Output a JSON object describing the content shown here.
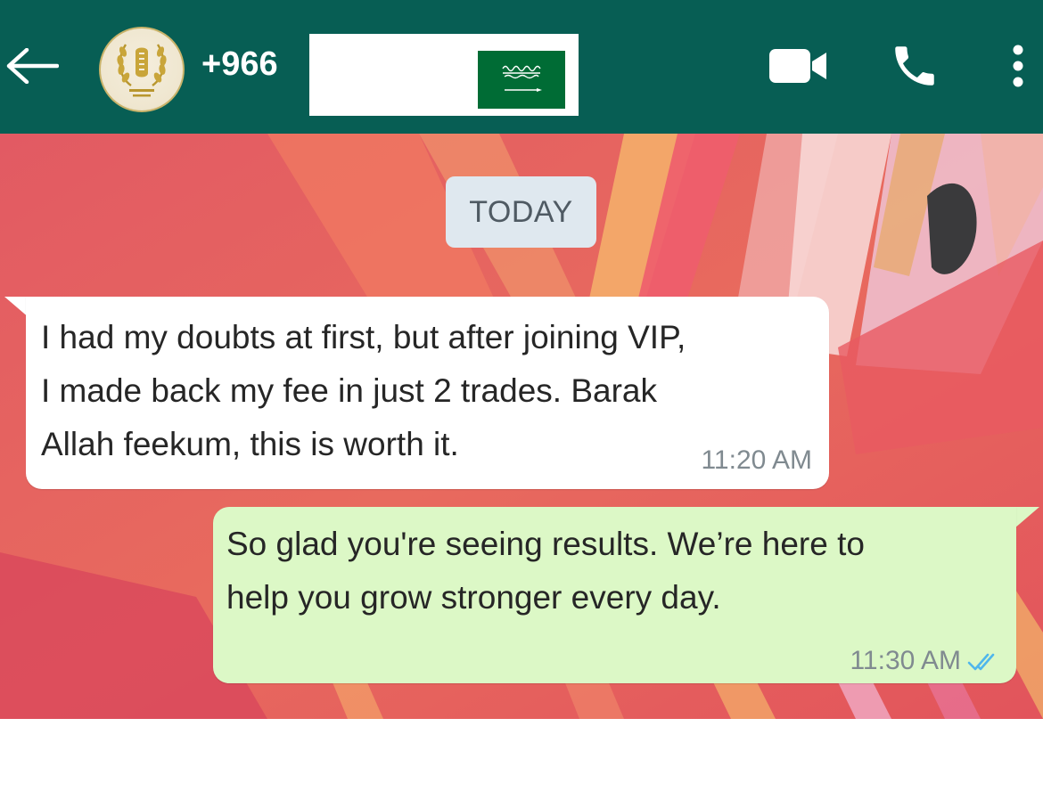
{
  "header": {
    "back_icon": "arrow-left-icon",
    "avatar_icon": "laurel-emblem-icon",
    "contact_name": "+966",
    "flag_icon": "saudi-flag-icon",
    "video_icon": "video-camera-icon",
    "call_icon": "phone-icon",
    "menu_icon": "vertical-dots-icon",
    "background_color": "#075e54"
  },
  "chat": {
    "date_label": "TODAY",
    "messages": [
      {
        "direction": "incoming",
        "lines": [
          "I had my doubts at first, but after joining VIP,",
          "I made back my fee in just 2 trades. Barak",
          "Allah feekum, this is worth it."
        ],
        "time": "11:20 AM",
        "bubble_color": "#ffffff"
      },
      {
        "direction": "outgoing",
        "lines": [
          "So glad you're seeing results. We’re here to",
          "help you grow stronger every day."
        ],
        "time": "11:30 AM",
        "status_icon": "double-check-read-icon",
        "bubble_color": "#dcf8c6"
      }
    ]
  }
}
